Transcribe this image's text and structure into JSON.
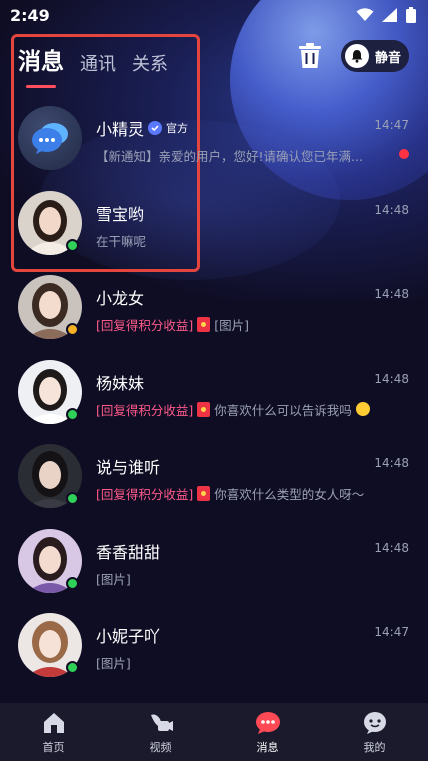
{
  "status_bar": {
    "time": "2:49"
  },
  "header": {
    "tabs": [
      {
        "label": "消息",
        "active": true
      },
      {
        "label": "通讯",
        "active": false
      },
      {
        "label": "关系",
        "active": false
      }
    ],
    "mute_label": "静音"
  },
  "conversations": [
    {
      "name": "小精灵",
      "official_label": "官方",
      "time": "14:47",
      "message": "【新通知】亲爱的用户，您好!请确认您已年满...",
      "unread": true,
      "status": "none"
    },
    {
      "name": "雪宝哟",
      "time": "14:48",
      "message": "在干嘛呢",
      "status": "online"
    },
    {
      "name": "小龙女",
      "time": "14:48",
      "tag": "[回复得积分收益]",
      "message": "[图片]",
      "status": "away"
    },
    {
      "name": "杨妹妹",
      "time": "14:48",
      "tag": "[回复得积分收益]",
      "message": "你喜欢什么可以告诉我吗",
      "status": "online"
    },
    {
      "name": "说与谁听",
      "time": "14:48",
      "tag": "[回复得积分收益]",
      "message": "你喜欢什么类型的女人呀～",
      "status": "online"
    },
    {
      "name": "香香甜甜",
      "time": "14:48",
      "message": "[图片]",
      "status": "online"
    },
    {
      "name": "小妮子吖",
      "time": "14:47",
      "message": "[图片]",
      "status": "online"
    }
  ],
  "bottom_nav": [
    {
      "label": "首页",
      "icon": "home-icon"
    },
    {
      "label": "视频",
      "icon": "video-icon"
    },
    {
      "label": "消息",
      "icon": "message-icon",
      "active": true
    },
    {
      "label": "我的",
      "icon": "profile-icon"
    }
  ],
  "colors": {
    "accent": "#ff4f5e",
    "online": "#2fd158",
    "away": "#f5b123",
    "reward_tag": "#ff5a8a",
    "highlight_box": "#e4453d"
  }
}
